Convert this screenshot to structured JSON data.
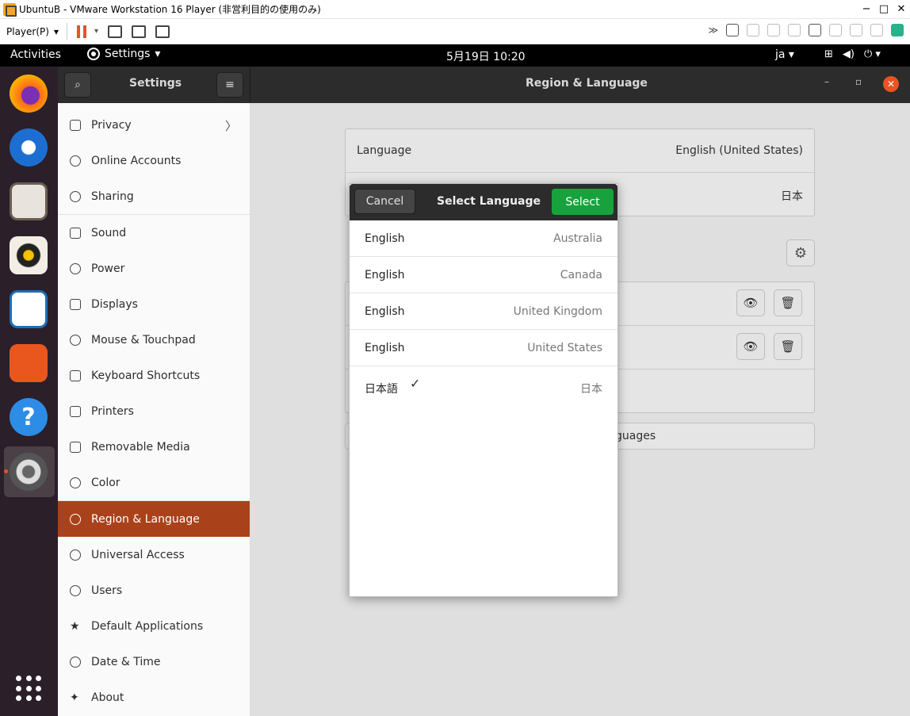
{
  "vm": {
    "title": "UbuntuB - VMware Workstation 16 Player (非営利目的の使用のみ)",
    "player_menu": "Player(P)",
    "win_min": "−",
    "win_max": "□",
    "win_close": "✕"
  },
  "topbar": {
    "activities": "Activities",
    "app_menu": "Settings",
    "clock": "5月19日  10:20",
    "input_method": "ja"
  },
  "settings": {
    "sidebar_title": "Settings",
    "page_title": "Region & Language",
    "sidebar_items": [
      {
        "label": "Privacy",
        "icon": "hand-icon"
      },
      {
        "label": "Online Accounts",
        "icon": "cloud-icon"
      },
      {
        "label": "Sharing",
        "icon": "share-icon"
      },
      {
        "label": "Sound",
        "icon": "music-note-icon"
      },
      {
        "label": "Power",
        "icon": "power-icon"
      },
      {
        "label": "Displays",
        "icon": "display-icon"
      },
      {
        "label": "Mouse & Touchpad",
        "icon": "mouse-icon"
      },
      {
        "label": "Keyboard Shortcuts",
        "icon": "keyboard-icon"
      },
      {
        "label": "Printers",
        "icon": "printer-icon"
      },
      {
        "label": "Removable Media",
        "icon": "usb-icon"
      },
      {
        "label": "Color",
        "icon": "color-icon"
      },
      {
        "label": "Region & Language",
        "icon": "globe-icon"
      },
      {
        "label": "Universal Access",
        "icon": "accessibility-icon"
      },
      {
        "label": "Users",
        "icon": "users-icon"
      },
      {
        "label": "Default Applications",
        "icon": "star-icon"
      },
      {
        "label": "Date & Time",
        "icon": "clock-icon"
      },
      {
        "label": "About",
        "icon": "sparkle-icon"
      }
    ],
    "main": {
      "language_label": "Language",
      "language_value": "English (United States)",
      "formats_value": "日本",
      "manage_button_partial": "guages"
    }
  },
  "dialog": {
    "cancel": "Cancel",
    "title": "Select Language",
    "select": "Select",
    "languages": [
      {
        "name": "English",
        "region": "Australia"
      },
      {
        "name": "English",
        "region": "Canada"
      },
      {
        "name": "English",
        "region": "United Kingdom"
      },
      {
        "name": "English",
        "region": "United States"
      },
      {
        "name": "日本語",
        "region": "日本",
        "checked": true
      }
    ]
  },
  "colors": {
    "accent": "#a9421b",
    "select_green": "#18a23d",
    "header_dark": "#2c2c2c",
    "dock_bg": "#2b1f2a"
  }
}
